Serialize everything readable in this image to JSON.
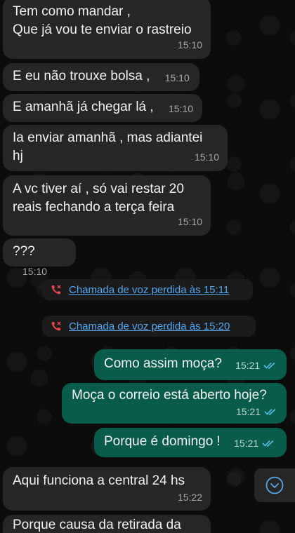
{
  "messages": [
    {
      "text": "Tem como mandar ,\nQue já vou te enviar o rastreio",
      "time": "15:10"
    },
    {
      "text": "E eu não trouxe bolsa ,",
      "time": "15:10"
    },
    {
      "text": "E amanhã já chegar lá ,",
      "time": "15:10"
    },
    {
      "text": "Ia enviar amanhã , mas adiantei\nhj",
      "time": "15:10"
    },
    {
      "text": "A vc tiver aí , só vai restar 20\nreais fechando a terça feira",
      "time": "15:10"
    },
    {
      "text": "???",
      "time": "15:10"
    },
    {
      "text": "Como assim moça?",
      "time": "15:21"
    },
    {
      "text": "Moça o correio está aberto hoje?",
      "time": "15:21"
    },
    {
      "text": "Porque é domingo !",
      "time": "15:21"
    },
    {
      "text": "Aqui funciona a central 24 hs",
      "time": "15:22"
    },
    {
      "text": "Porque causa da retirada da",
      "time": ""
    }
  ],
  "missed_calls": [
    {
      "label": "Chamada de voz perdida às 15:11"
    },
    {
      "label": "Chamada de voz perdida às 15:20"
    }
  ],
  "colors": {
    "incoming_bubble": "#262626",
    "outgoing_bubble": "#0a5c4a",
    "read_ticks": "#53bdeb",
    "missed_call_icon": "#f0474a",
    "link_text": "#52a7f0"
  },
  "icons": {
    "missed_call": "missed-call-icon",
    "read_receipt": "double-check-icon",
    "scroll_down": "chevron-down-icon"
  }
}
